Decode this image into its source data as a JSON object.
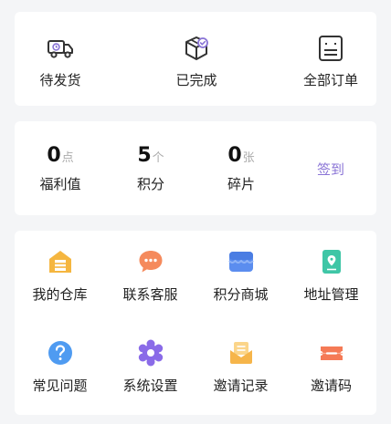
{
  "orders": [
    {
      "label": "待发货",
      "icon": "delivery-truck-icon"
    },
    {
      "label": "已完成",
      "icon": "box-check-icon"
    },
    {
      "label": "全部订单",
      "icon": "order-list-icon"
    }
  ],
  "stats": [
    {
      "value": "0",
      "unit": "点",
      "label": "福利值"
    },
    {
      "value": "5",
      "unit": "个",
      "label": "积分"
    },
    {
      "value": "0",
      "unit": "张",
      "label": "碎片"
    }
  ],
  "signin_label": "签到",
  "menu": [
    {
      "label": "我的仓库",
      "icon": "warehouse-icon",
      "color": "#f5b640"
    },
    {
      "label": "联系客服",
      "icon": "chat-bubble-icon",
      "color": "#f58a5c"
    },
    {
      "label": "积分商城",
      "icon": "store-icon",
      "color": "#5b8def"
    },
    {
      "label": "地址管理",
      "icon": "location-book-icon",
      "color": "#3fc6a6"
    },
    {
      "label": "常见问题",
      "icon": "question-icon",
      "color": "#4f9bf1"
    },
    {
      "label": "系统设置",
      "icon": "gear-icon",
      "color": "#8a6be8"
    },
    {
      "label": "邀请记录",
      "icon": "envelope-icon",
      "color": "#f6b54a"
    },
    {
      "label": "邀请码",
      "icon": "ticket-icon",
      "color": "#f57a56"
    }
  ],
  "colors": {
    "background": "#f4f5f7",
    "card": "#ffffff",
    "accent_signin": "#8a74d6",
    "unit_gray": "#aaaaaa"
  }
}
